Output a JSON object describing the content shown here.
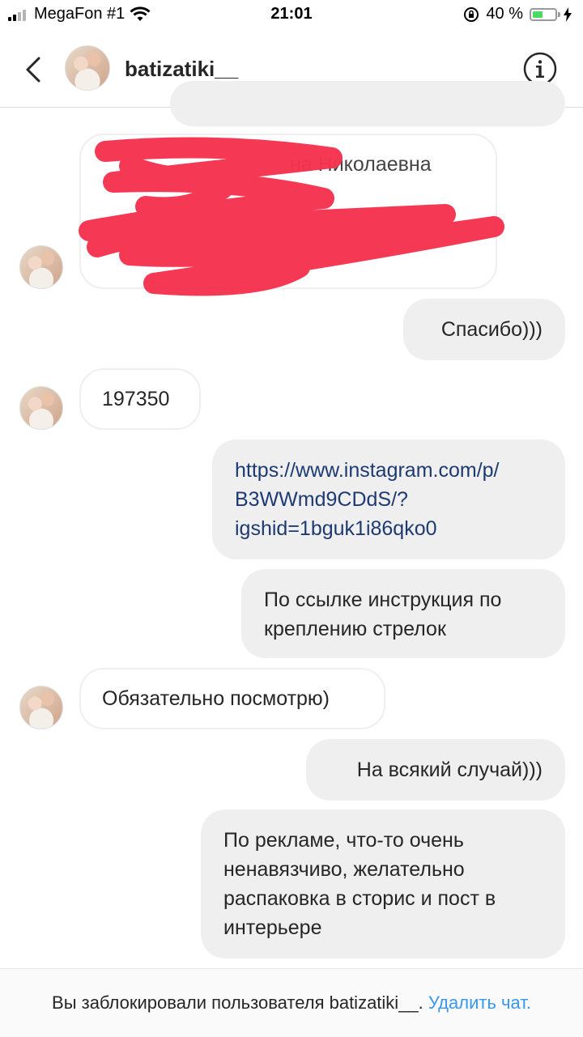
{
  "status_bar": {
    "carrier": "MegaFon #1",
    "time": "21:01",
    "battery": "40 %",
    "battery_level": 0.4
  },
  "header": {
    "username": "batizatiki__",
    "back_icon": "chevron-left-icon",
    "info_icon": "info-icon"
  },
  "messages": [
    {
      "side": "in",
      "text": "Спасибо)))"
    },
    {
      "side": "in",
      "redacted_partial": "на Николаевна"
    },
    {
      "side": "out",
      "text": "Спасибо)))"
    },
    {
      "side": "in",
      "text": "197350"
    },
    {
      "side": "out",
      "text": "https://www.instagram.com/p/B3WWmd9CDdS/?igshid=1bguk1i86qko0"
    },
    {
      "side": "out",
      "text": "По ссылке инструкция по креплению стрелок"
    },
    {
      "side": "in",
      "text": "Обязательно посмотрю)"
    },
    {
      "side": "out",
      "text": "На всякий случай)))"
    },
    {
      "side": "out",
      "text": "По рекламе, что-то очень ненавязчиво, желательно распаковка в сторис и пост в интерьере"
    }
  ],
  "link_lines": [
    "https://www.instagram.com/p/",
    "B3WWmd9CDdS/?",
    "igshid=1bguk1i86qko0"
  ],
  "instruction_lines": [
    "По ссылке инструкция по",
    "креплению стрелок"
  ],
  "ad_lines": [
    "По рекламе, что-то очень",
    "ненавязчиво, желательно",
    "распаковка в сторис и пост в",
    "интерьере"
  ],
  "footer": {
    "notice": "Вы заблокировали пользователя batizatiki__.",
    "action": "Удалить чат."
  },
  "colors": {
    "accent": "#3897f0",
    "bubble_out": "#efefef",
    "link": "#1e3a72",
    "redaction": "#f5334f"
  }
}
